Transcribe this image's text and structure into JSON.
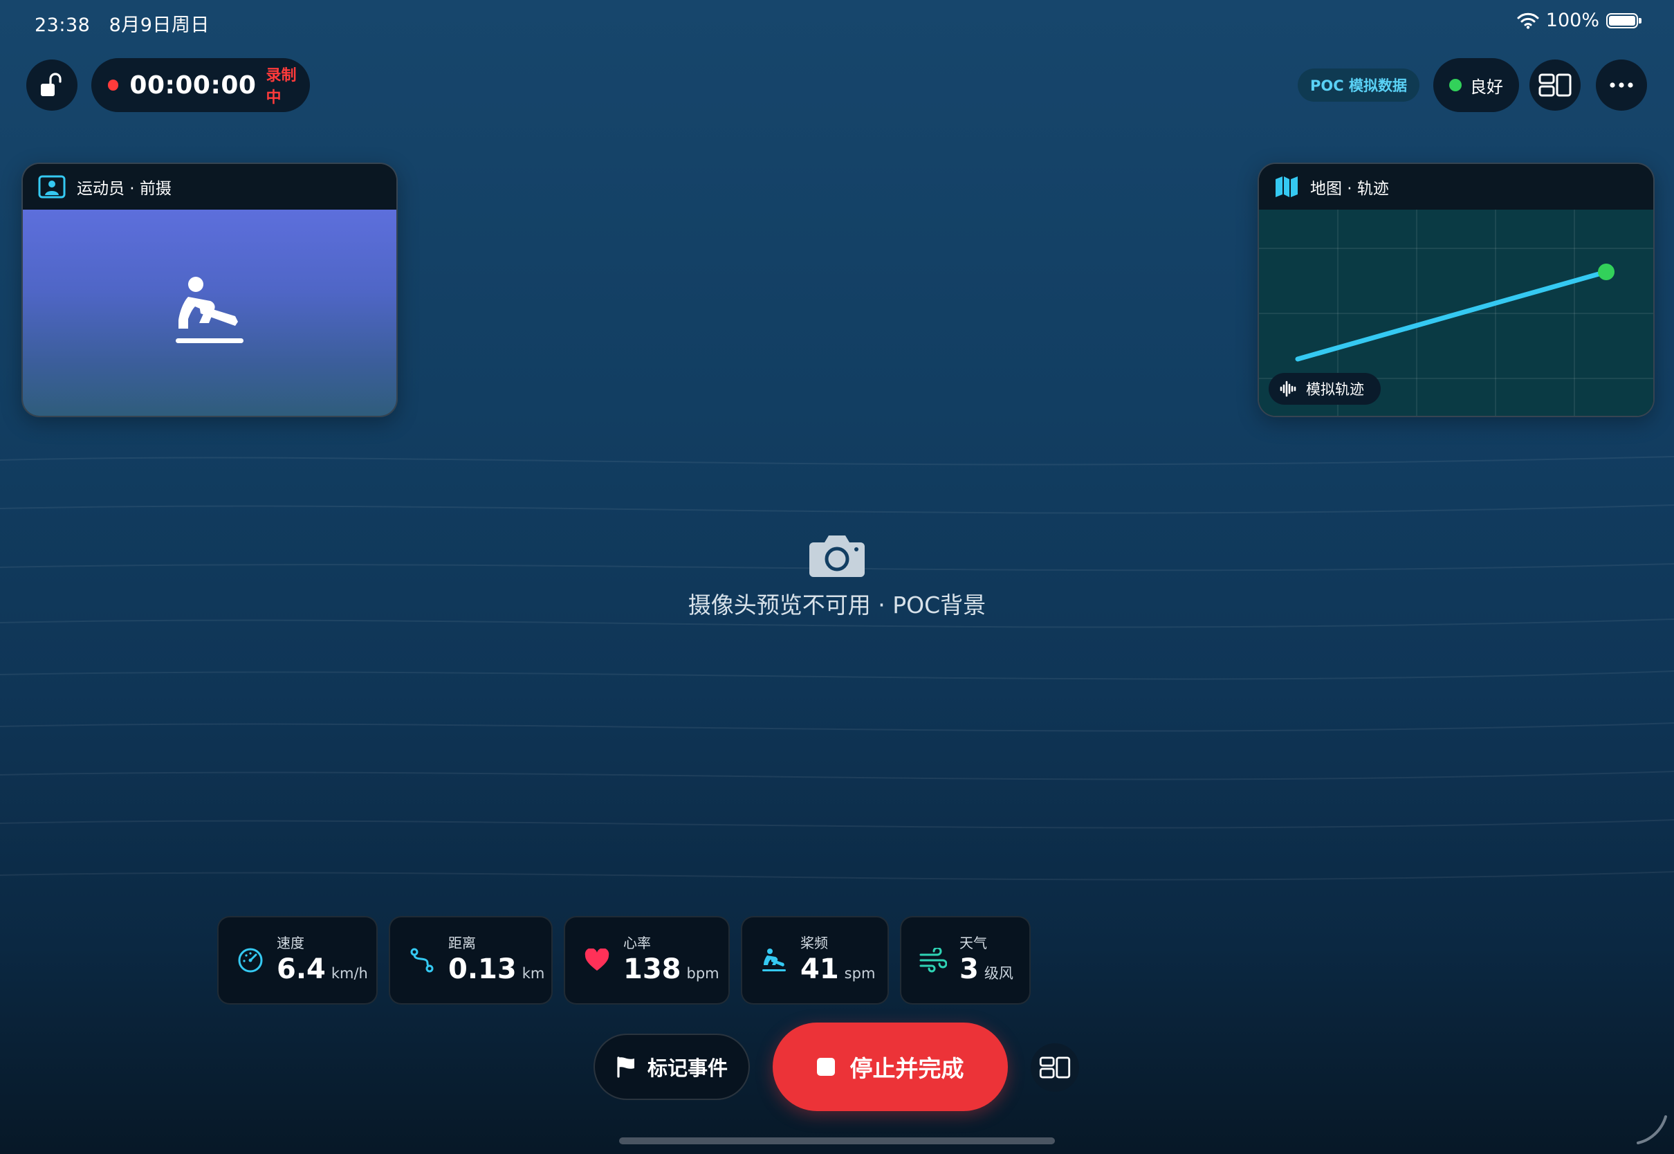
{
  "status_bar": {
    "time": "23:38",
    "date": "8月9日周日",
    "battery": "100%"
  },
  "recording": {
    "timer": "00:00:00",
    "label": "录制中"
  },
  "top_right": {
    "poc_badge": "POC 模拟数据",
    "quality": "良好"
  },
  "athlete_card": {
    "title": "运动员 · 前摄"
  },
  "map_card": {
    "title": "地图 · 轨迹",
    "chip": "模拟轨迹"
  },
  "camera_notice": "摄像头预览不可用 · POC背景",
  "metrics": [
    {
      "label": "速度",
      "value": "6.4",
      "unit": "km/h",
      "icon": "speedometer-icon"
    },
    {
      "label": "距离",
      "value": "0.13",
      "unit": "km",
      "icon": "route-icon"
    },
    {
      "label": "心率",
      "value": "138",
      "unit": "bpm",
      "icon": "heart-icon"
    },
    {
      "label": "桨频",
      "value": "41",
      "unit": "spm",
      "icon": "rowing-icon"
    },
    {
      "label": "天气",
      "value": "3",
      "unit": "级风",
      "icon": "wind-icon"
    }
  ],
  "actions": {
    "mark_event": "标记事件",
    "stop_finish": "停止并完成"
  },
  "colors": {
    "accent_cyan": "#35c9f2",
    "record_red": "#ff3b3b",
    "stop_red": "#ec3338",
    "good_green": "#32d15a"
  }
}
